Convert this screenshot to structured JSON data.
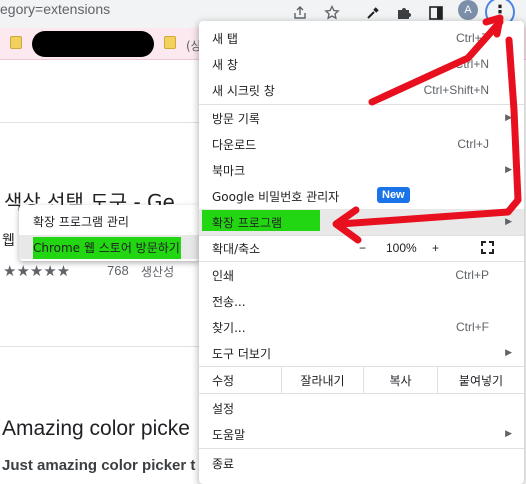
{
  "toolbar": {
    "url_text": "egory=extensions",
    "avatar_letter": "A"
  },
  "bookmarks": {
    "partial_text": "(상"
  },
  "page": {
    "title": "색상 선택 도구 - Ge",
    "web_prefix": "웹",
    "stars": "★★★★★",
    "rating_count": "768",
    "rating_category": "생산성",
    "amazing_title": "Amazing color picke",
    "just_text": "Just amazing color picker t"
  },
  "menu": {
    "new_tab": {
      "label": "새 탭",
      "shortcut": "Ctrl+T"
    },
    "new_window": {
      "label": "새 창",
      "shortcut": "Ctrl+N"
    },
    "incognito": {
      "label": "새 시크릿 창",
      "shortcut": "Ctrl+Shift+N"
    },
    "history": {
      "label": "방문 기록"
    },
    "downloads": {
      "label": "다운로드",
      "shortcut": "Ctrl+J"
    },
    "bookmarks": {
      "label": "북마크"
    },
    "passwords": {
      "label": "Google 비밀번호 관리자",
      "badge": "New"
    },
    "extensions": {
      "label": "확장 프로그램"
    },
    "zoom": {
      "label": "확대/축소",
      "minus": "−",
      "value": "100%",
      "plus": "+"
    },
    "print": {
      "label": "인쇄",
      "shortcut": "Ctrl+P"
    },
    "cast": {
      "label": "전송..."
    },
    "find": {
      "label": "찾기...",
      "shortcut": "Ctrl+F"
    },
    "more_tools": {
      "label": "도구 더보기"
    },
    "edit": {
      "label": "수정",
      "cut": "잘라내기",
      "copy": "복사",
      "paste": "붙여넣기"
    },
    "settings": {
      "label": "설정"
    },
    "help": {
      "label": "도움말"
    },
    "exit": {
      "label": "종료"
    }
  },
  "submenu": {
    "manage": "확장 프로그램 관리",
    "store": "Chrome 웹 스토어 방문하기"
  },
  "colors": {
    "annotation_red": "#e8101e",
    "highlight_green": "#22d611",
    "badge_blue": "#1a73e8"
  },
  "icons": [
    "share-icon",
    "star-icon",
    "eyedropper-icon",
    "puzzle-icon",
    "sidepanel-icon",
    "kebab-menu-icon",
    "fullscreen-icon",
    "submenu-arrow-icon"
  ]
}
